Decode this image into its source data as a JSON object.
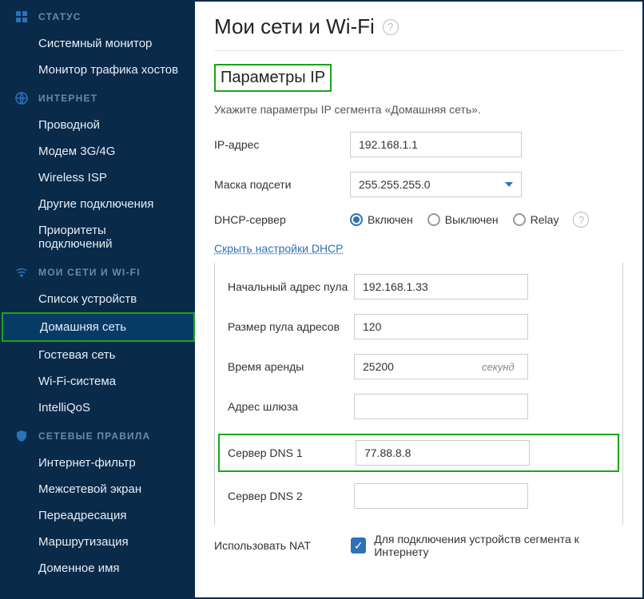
{
  "sidebar": {
    "sections": [
      {
        "label": "СТАТУС",
        "items": [
          "Системный монитор",
          "Монитор трафика хостов"
        ]
      },
      {
        "label": "ИНТЕРНЕТ",
        "items": [
          "Проводной",
          "Модем 3G/4G",
          "Wireless ISP",
          "Другие подключения",
          "Приоритеты подключений"
        ]
      },
      {
        "label": "МОИ СЕТИ И WI-FI",
        "items": [
          "Список устройств",
          "Домашняя сеть",
          "Гостевая сеть",
          "Wi-Fi-система",
          "IntelliQoS"
        ]
      },
      {
        "label": "СЕТЕВЫЕ ПРАВИЛА",
        "items": [
          "Интернет-фильтр",
          "Межсетевой экран",
          "Переадресация",
          "Маршрутизация",
          "Доменное имя"
        ]
      }
    ]
  },
  "page": {
    "title": "Мои сети и Wi-Fi",
    "section_title": "Параметры IP",
    "subtext": "Укажите параметры IP сегмента «Домашняя сеть».",
    "labels": {
      "ip": "IP-адрес",
      "mask": "Маска подсети",
      "dhcp": "DHCP-сервер",
      "hide_dhcp": "Скрыть настройки DHCP",
      "pool_start": "Начальный адрес пула",
      "pool_size": "Размер пула адресов",
      "lease": "Время аренды",
      "lease_unit": "секунд",
      "gateway": "Адрес шлюза",
      "dns1": "Сервер DNS 1",
      "dns2": "Сервер DNS 2",
      "use_nat": "Использовать NAT",
      "nat_text": "Для подключения устройств сегмента к Интернету"
    },
    "values": {
      "ip": "192.168.1.1",
      "mask": "255.255.255.0",
      "pool_start": "192.168.1.33",
      "pool_size": "120",
      "lease": "25200",
      "gateway": "",
      "dns1": "77.88.8.8",
      "dns2": ""
    },
    "dhcp_options": {
      "on": "Включен",
      "off": "Выключен",
      "relay": "Relay"
    }
  }
}
